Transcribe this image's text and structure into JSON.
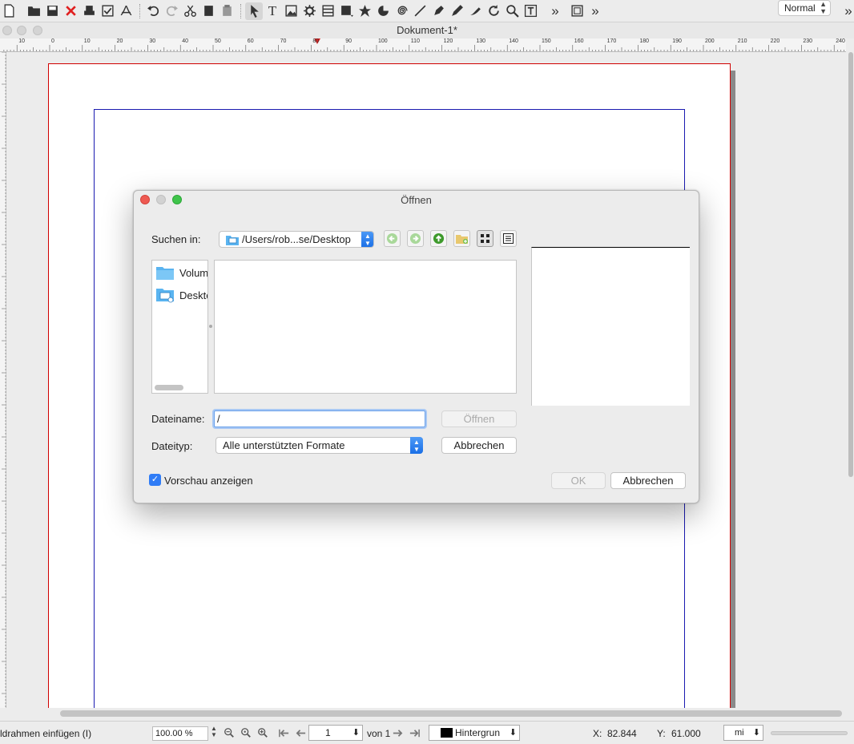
{
  "toolbar": {
    "icons": [
      "new-document-icon",
      "open-folder-icon",
      "save-icon",
      "close-red-x-icon",
      "print-icon",
      "preflight-check-icon",
      "export-pdf-icon",
      "undo-icon",
      "redo-icon",
      "cut-icon",
      "copy-icon",
      "paste-icon",
      "select-arrow-icon",
      "text-frame-icon",
      "image-frame-icon",
      "render-frame-icon",
      "table-icon",
      "shape-icon",
      "polygon-star-icon",
      "arc-icon",
      "spiral-icon",
      "line-icon",
      "bezier-pen-icon",
      "freehand-pencil-icon",
      "calligraphic-pen-icon",
      "rotate-icon",
      "zoom-magnifier-icon",
      "edit-text-icon"
    ],
    "overflow_glyph": "»",
    "mode_select": "Normal"
  },
  "document": {
    "title": "Dokument-1*"
  },
  "ruler": {
    "labels": [
      "10",
      "0",
      "10",
      "20",
      "30",
      "40",
      "50",
      "60",
      "70",
      "80",
      "90",
      "100",
      "110",
      "120",
      "130",
      "140",
      "150",
      "160",
      "170",
      "180",
      "190",
      "200",
      "210",
      "220",
      "230",
      "240"
    ]
  },
  "dialog": {
    "title": "Öffnen",
    "look_in_label": "Suchen in:",
    "look_in_path": "/Users/rob...se/Desktop",
    "sidebar_items": [
      {
        "label": "Volumes",
        "icon": "folder-icon"
      },
      {
        "label": "Desktop",
        "icon": "desktop-folder-icon"
      }
    ],
    "filename_label": "Dateiname:",
    "filename_value": "/",
    "filetype_label": "Dateityp:",
    "filetype_value": "Alle unterstützten Formate",
    "open_button": "Öffnen",
    "cancel_button_inner": "Abbrechen",
    "preview_checkbox_label": "Vorschau anzeigen",
    "preview_checked": true,
    "ok_button": "OK",
    "cancel_button": "Abbrechen"
  },
  "statusbar": {
    "message": "ldrahmen einfügen (I)",
    "zoom": "100.00 %",
    "page_current": "1",
    "page_of": "von 1",
    "layer": "Hintergrun",
    "x_label": "X:",
    "x_value": "82.844",
    "y_label": "Y:",
    "y_value": "61.000",
    "unit": "mi"
  },
  "colors": {
    "page_border": "#d00000",
    "margin_guide": "#1a1ab0",
    "accent_blue": "#2f7cf6",
    "close_red": "#e0443e"
  }
}
